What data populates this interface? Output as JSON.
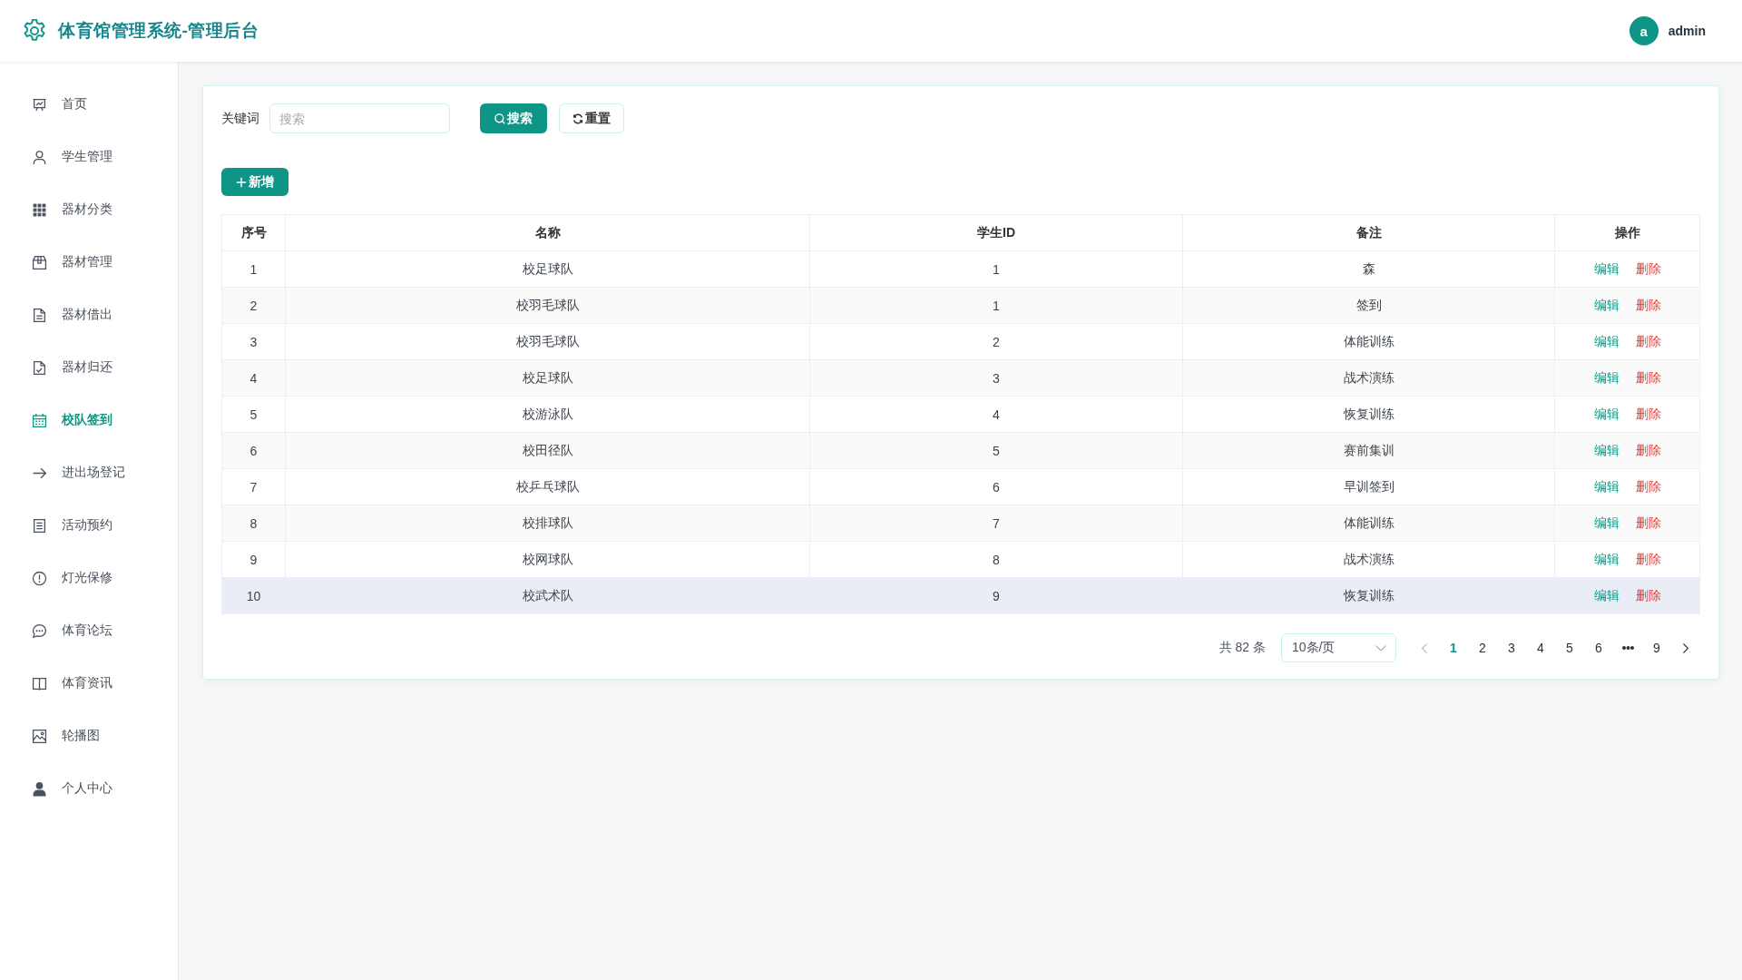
{
  "header": {
    "title": "体育馆管理系统-管理后台",
    "user": {
      "avatar_letter": "a",
      "name": "admin"
    }
  },
  "sidebar": {
    "items": [
      {
        "label": "首页",
        "selected": false
      },
      {
        "label": "学生管理",
        "selected": false
      },
      {
        "label": "器材分类",
        "selected": false
      },
      {
        "label": "器材管理",
        "selected": false
      },
      {
        "label": "器材借出",
        "selected": false
      },
      {
        "label": "器材归还",
        "selected": false
      },
      {
        "label": "校队签到",
        "selected": true
      },
      {
        "label": "进出场登记",
        "selected": false
      },
      {
        "label": "活动预约",
        "selected": false
      },
      {
        "label": "灯光保修",
        "selected": false
      },
      {
        "label": "体育论坛",
        "selected": false
      },
      {
        "label": "体育资讯",
        "selected": false
      },
      {
        "label": "轮播图",
        "selected": false
      },
      {
        "label": "个人中心",
        "selected": false
      }
    ]
  },
  "search": {
    "label": "关键词",
    "placeholder": "搜索",
    "search_button": "搜索",
    "reset_button": "重置"
  },
  "add_button": "新增",
  "table": {
    "columns": [
      "序号",
      "名称",
      "学生ID",
      "备注",
      "操作"
    ],
    "rows": [
      {
        "cells": [
          "1",
          "校足球队",
          "1",
          "森"
        ],
        "hovered": false,
        "actions": [
          {
            "kind": "edit",
            "label": "编辑"
          },
          {
            "kind": "delete",
            "label": "删除"
          }
        ]
      },
      {
        "cells": [
          "2",
          "校羽毛球队",
          "1",
          "签到"
        ],
        "hovered": false,
        "actions": [
          {
            "kind": "edit",
            "label": "编辑"
          },
          {
            "kind": "delete",
            "label": "删除"
          }
        ]
      },
      {
        "cells": [
          "3",
          "校羽毛球队",
          "2",
          "体能训练"
        ],
        "hovered": false,
        "actions": [
          {
            "kind": "edit",
            "label": "编辑"
          },
          {
            "kind": "delete",
            "label": "删除"
          }
        ]
      },
      {
        "cells": [
          "4",
          "校足球队",
          "3",
          "战术演练"
        ],
        "hovered": false,
        "actions": [
          {
            "kind": "edit",
            "label": "编辑"
          },
          {
            "kind": "delete",
            "label": "删除"
          }
        ]
      },
      {
        "cells": [
          "5",
          "校游泳队",
          "4",
          "恢复训练"
        ],
        "hovered": false,
        "actions": [
          {
            "kind": "edit",
            "label": "编辑"
          },
          {
            "kind": "delete",
            "label": "删除"
          }
        ]
      },
      {
        "cells": [
          "6",
          "校田径队",
          "5",
          "赛前集训"
        ],
        "hovered": false,
        "actions": [
          {
            "kind": "edit",
            "label": "编辑"
          },
          {
            "kind": "delete",
            "label": "删除"
          }
        ]
      },
      {
        "cells": [
          "7",
          "校乒乓球队",
          "6",
          "早训签到"
        ],
        "hovered": false,
        "actions": [
          {
            "kind": "edit",
            "label": "编辑"
          },
          {
            "kind": "delete",
            "label": "删除"
          }
        ]
      },
      {
        "cells": [
          "8",
          "校排球队",
          "7",
          "体能训练"
        ],
        "hovered": false,
        "actions": [
          {
            "kind": "edit",
            "label": "编辑"
          },
          {
            "kind": "delete",
            "label": "删除"
          }
        ]
      },
      {
        "cells": [
          "9",
          "校网球队",
          "8",
          "战术演练"
        ],
        "hovered": false,
        "actions": [
          {
            "kind": "edit",
            "label": "编辑"
          },
          {
            "kind": "delete",
            "label": "删除"
          }
        ]
      },
      {
        "cells": [
          "10",
          "校武术队",
          "9",
          "恢复训练"
        ],
        "hovered": true,
        "actions": [
          {
            "kind": "edit",
            "label": "编辑"
          },
          {
            "kind": "delete",
            "label": "删除"
          }
        ]
      }
    ]
  },
  "pagination": {
    "total": "共 82 条",
    "page_size": "10条/页",
    "prev": {
      "disabled": true
    },
    "pages": [
      {
        "kind": "page",
        "label": "1",
        "selected": true
      },
      {
        "kind": "page",
        "label": "2",
        "selected": false
      },
      {
        "kind": "page",
        "label": "3",
        "selected": false
      },
      {
        "kind": "page",
        "label": "4",
        "selected": false
      },
      {
        "kind": "page",
        "label": "5",
        "selected": false
      },
      {
        "kind": "page",
        "label": "6",
        "selected": false
      },
      {
        "kind": "ellipsis",
        "selected": false
      },
      {
        "kind": "page",
        "label": "9",
        "selected": false
      }
    ],
    "next": {
      "disabled": false
    }
  }
}
